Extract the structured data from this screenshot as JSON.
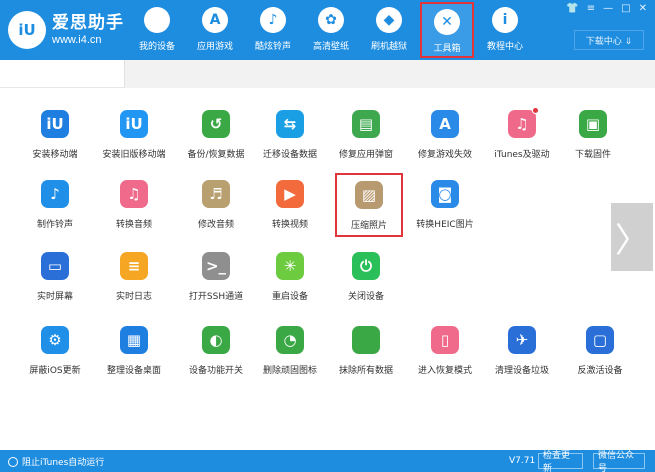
{
  "app": {
    "logo_text": "iU",
    "name": "爱思助手",
    "url": "www.i4.cn"
  },
  "nav": [
    {
      "label": "我的设备",
      "icon": "apple-icon",
      "glyph": ""
    },
    {
      "label": "应用游戏",
      "icon": "app-store-icon",
      "glyph": "A"
    },
    {
      "label": "酷炫铃声",
      "icon": "bell-icon",
      "glyph": "♪"
    },
    {
      "label": "高清壁纸",
      "icon": "flower-icon",
      "glyph": "✿"
    },
    {
      "label": "刷机越狱",
      "icon": "dropbox-icon",
      "glyph": "◆"
    },
    {
      "label": "工具箱",
      "icon": "tools-icon",
      "glyph": "✕"
    },
    {
      "label": "教程中心",
      "icon": "info-icon",
      "glyph": "i"
    }
  ],
  "window_controls": {
    "shirt": "👕",
    "wifi": "≡",
    "minimize": "—",
    "maximize": "□",
    "close": "✕"
  },
  "download_center": "下载中心 ⇓",
  "tools": [
    {
      "label": "安装移动端",
      "icon": "iu-logo-icon",
      "glyph": "iU",
      "color": "#1f7fe0"
    },
    {
      "label": "安装旧版移动端",
      "icon": "iu-logo-old-icon",
      "glyph": "iU",
      "color": "#2196f3"
    },
    {
      "label": "备份/恢复数据",
      "icon": "backup-restore-icon",
      "glyph": "↺",
      "color": "#3aa845"
    },
    {
      "label": "迁移设备数据",
      "icon": "migrate-data-icon",
      "glyph": "⇆",
      "color": "#1a9fe5"
    },
    {
      "label": "修复应用弹窗",
      "icon": "repair-app-icon",
      "glyph": "▤",
      "color": "#3ea84f"
    },
    {
      "label": "修复游戏失效",
      "icon": "repair-game-icon",
      "glyph": "A",
      "color": "#2a8ae8"
    },
    {
      "label": "iTunes及驱动",
      "icon": "itunes-icon",
      "glyph": "♫",
      "color": "#ef6a8a"
    },
    {
      "label": "下载固件",
      "icon": "firmware-box-icon",
      "glyph": "▣",
      "color": "#3aa845"
    },
    {
      "label": "制作铃声",
      "icon": "ringtone-bell-icon",
      "glyph": "♪",
      "color": "#1f8fe8"
    },
    {
      "label": "转换音频",
      "icon": "audio-convert-icon",
      "glyph": "♫",
      "color": "#f06a8c"
    },
    {
      "label": "修改音频",
      "icon": "audio-edit-icon",
      "glyph": "♬",
      "color": "#b8a070"
    },
    {
      "label": "转换视频",
      "icon": "video-convert-icon",
      "glyph": "▶",
      "color": "#f36a3c"
    },
    {
      "label": "压缩照片",
      "icon": "image-compress-icon",
      "glyph": "▨",
      "color": "#b89a70"
    },
    {
      "label": "转换HEIC图片",
      "icon": "heic-image-icon",
      "glyph": "◙",
      "color": "#2a8ae8"
    },
    {
      "label": "实时屏幕",
      "icon": "monitor-icon",
      "glyph": "▭",
      "color": "#2a6fd8"
    },
    {
      "label": "实时日志",
      "icon": "log-doc-icon",
      "glyph": "≡",
      "color": "#f5a623"
    },
    {
      "label": "打开SSH通道",
      "icon": "terminal-icon",
      "glyph": ">_",
      "color": "#8f8f8f"
    },
    {
      "label": "重启设备",
      "icon": "restart-icon",
      "glyph": "✳",
      "color": "#6ccb3f"
    },
    {
      "label": "关闭设备",
      "icon": "power-icon",
      "glyph": "⏻",
      "color": "#2bbf5a"
    },
    {
      "label": "屏蔽iOS更新",
      "icon": "block-update-icon",
      "glyph": "⚙",
      "color": "#1f8fe8"
    },
    {
      "label": "整理设备桌面",
      "icon": "desktop-grid-icon",
      "glyph": "▦",
      "color": "#1f7fe0"
    },
    {
      "label": "设备功能开关",
      "icon": "toggle-switch-icon",
      "glyph": "◐",
      "color": "#3aa845"
    },
    {
      "label": "删除顽固图标",
      "icon": "delete-icon-icon",
      "glyph": "◔",
      "color": "#3aa845"
    },
    {
      "label": "抹除所有数据",
      "icon": "erase-data-icon",
      "glyph": "",
      "color": "#3aa845"
    },
    {
      "label": "进入恢复模式",
      "icon": "recovery-mode-icon",
      "glyph": "▯",
      "color": "#f06a8c"
    },
    {
      "label": "清理设备垃圾",
      "icon": "clean-junk-icon",
      "glyph": "✈",
      "color": "#2a6fd8"
    },
    {
      "label": "反激活设备",
      "icon": "deactivate-icon",
      "glyph": "▢",
      "color": "#2a6fd8"
    }
  ],
  "next_arrow": "〉",
  "footer": {
    "block_itunes": "阻止iTunes自动运行",
    "version": "V7.71",
    "check_update": "检查更新",
    "wechat": "微信公众号"
  }
}
